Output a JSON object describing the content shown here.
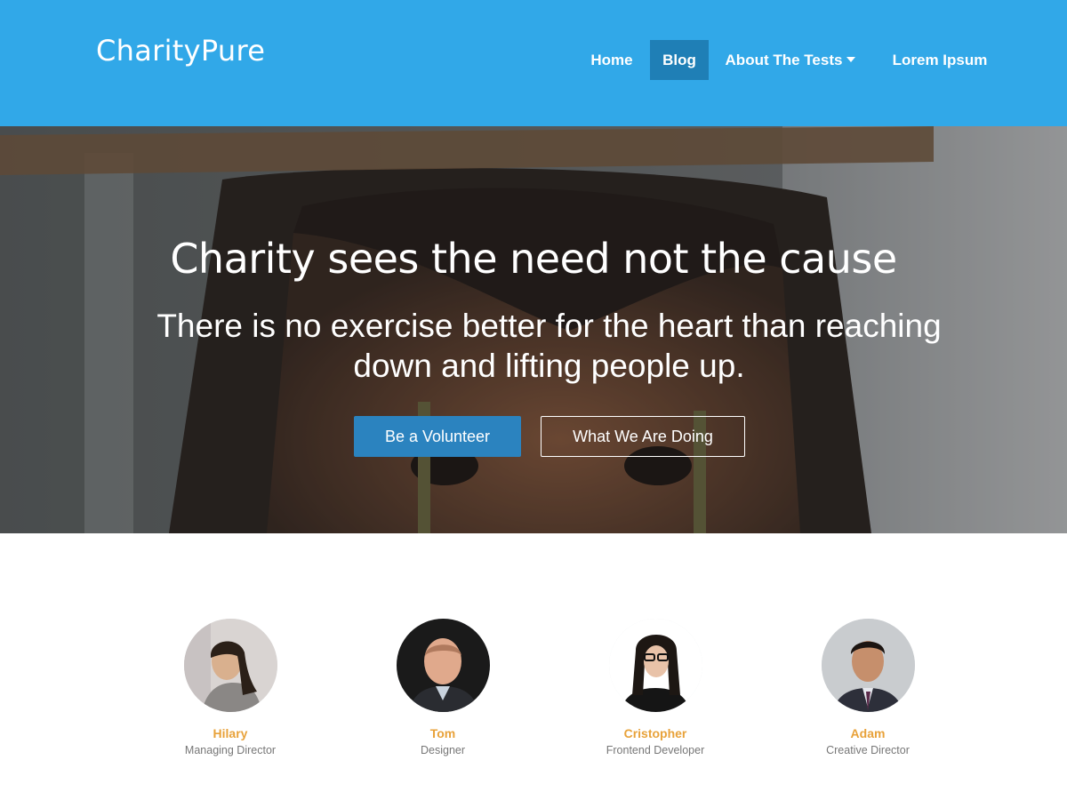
{
  "header": {
    "logo": "CharityPure",
    "nav": [
      {
        "label": "Home"
      },
      {
        "label": "Blog",
        "active": true
      },
      {
        "label": "About The Tests",
        "has_dropdown": true
      },
      {
        "label": "Lorem Ipsum"
      }
    ],
    "colors": {
      "header_bg": "#31a8e8",
      "active_nav_bg": "#1f7fb6"
    }
  },
  "hero": {
    "title": "Charity sees the need not the cause",
    "subtitle": "There is no exercise better for the heart than reaching down and lifting people up.",
    "primary_button": "Be a Volunteer",
    "secondary_button": "What We Are Doing",
    "colors": {
      "primary_button_bg": "#2b83bf"
    }
  },
  "team": {
    "members": [
      {
        "name": "Hilary",
        "role": "Managing Director"
      },
      {
        "name": "Tom",
        "role": "Designer"
      },
      {
        "name": "Cristopher",
        "role": "Frontend Developer"
      },
      {
        "name": "Adam",
        "role": "Creative Director"
      }
    ],
    "colors": {
      "name_color": "#e8a23a",
      "role_color": "#777777"
    }
  }
}
